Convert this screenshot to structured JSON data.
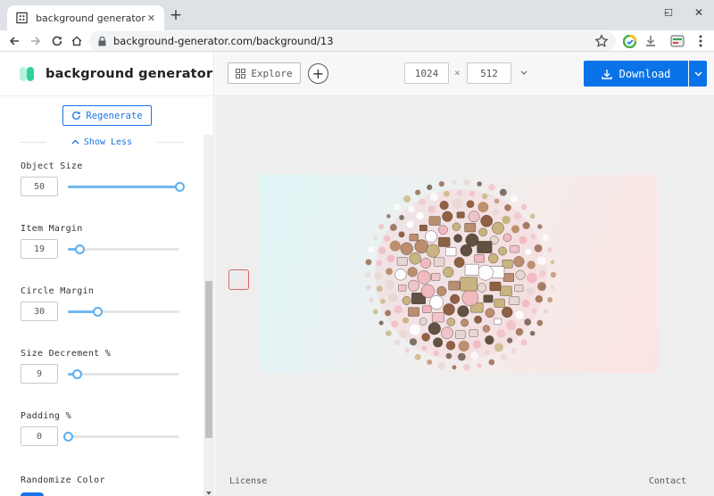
{
  "browser": {
    "tab_title": "background generator",
    "tab_close": "✕",
    "new_tab": "+",
    "url": "background-generator.com/background/13",
    "window_controls": {
      "minimize": "–",
      "maximize": "☐",
      "close": "✕"
    }
  },
  "app": {
    "logo_text": "background generator",
    "logo_colors": [
      "#b6f3df",
      "#2fd1a0"
    ],
    "regenerate_label": "Regenerate",
    "show_less_label": "Show Less",
    "controls": [
      {
        "label": "Object Size",
        "value": "50",
        "fraction": 1.0
      },
      {
        "label": "Item Margin",
        "value": "19",
        "fraction": 0.1
      },
      {
        "label": "Circle Margin",
        "value": "30",
        "fraction": 0.26
      },
      {
        "label": "Size Decrement %",
        "value": "9",
        "fraction": 0.08
      },
      {
        "label": "Padding %",
        "value": "0",
        "fraction": 0.0
      }
    ],
    "randomize_color_label": "Randomize Color",
    "accent_color": "#1a73e8"
  },
  "toolbar": {
    "explore_label": "Explore",
    "width_value": "1024",
    "times_symbol": "×",
    "height_value": "512",
    "download_label": "Download"
  },
  "footer": {
    "license_label": "License",
    "contact_label": "Contact"
  },
  "preview": {
    "palette": [
      "#f3b7bf",
      "#e7d7d2",
      "#c7b27c",
      "#8a5a3b",
      "#b98a6a",
      "#ffffff",
      "#5a4a3a",
      "#f0c4c9"
    ]
  }
}
